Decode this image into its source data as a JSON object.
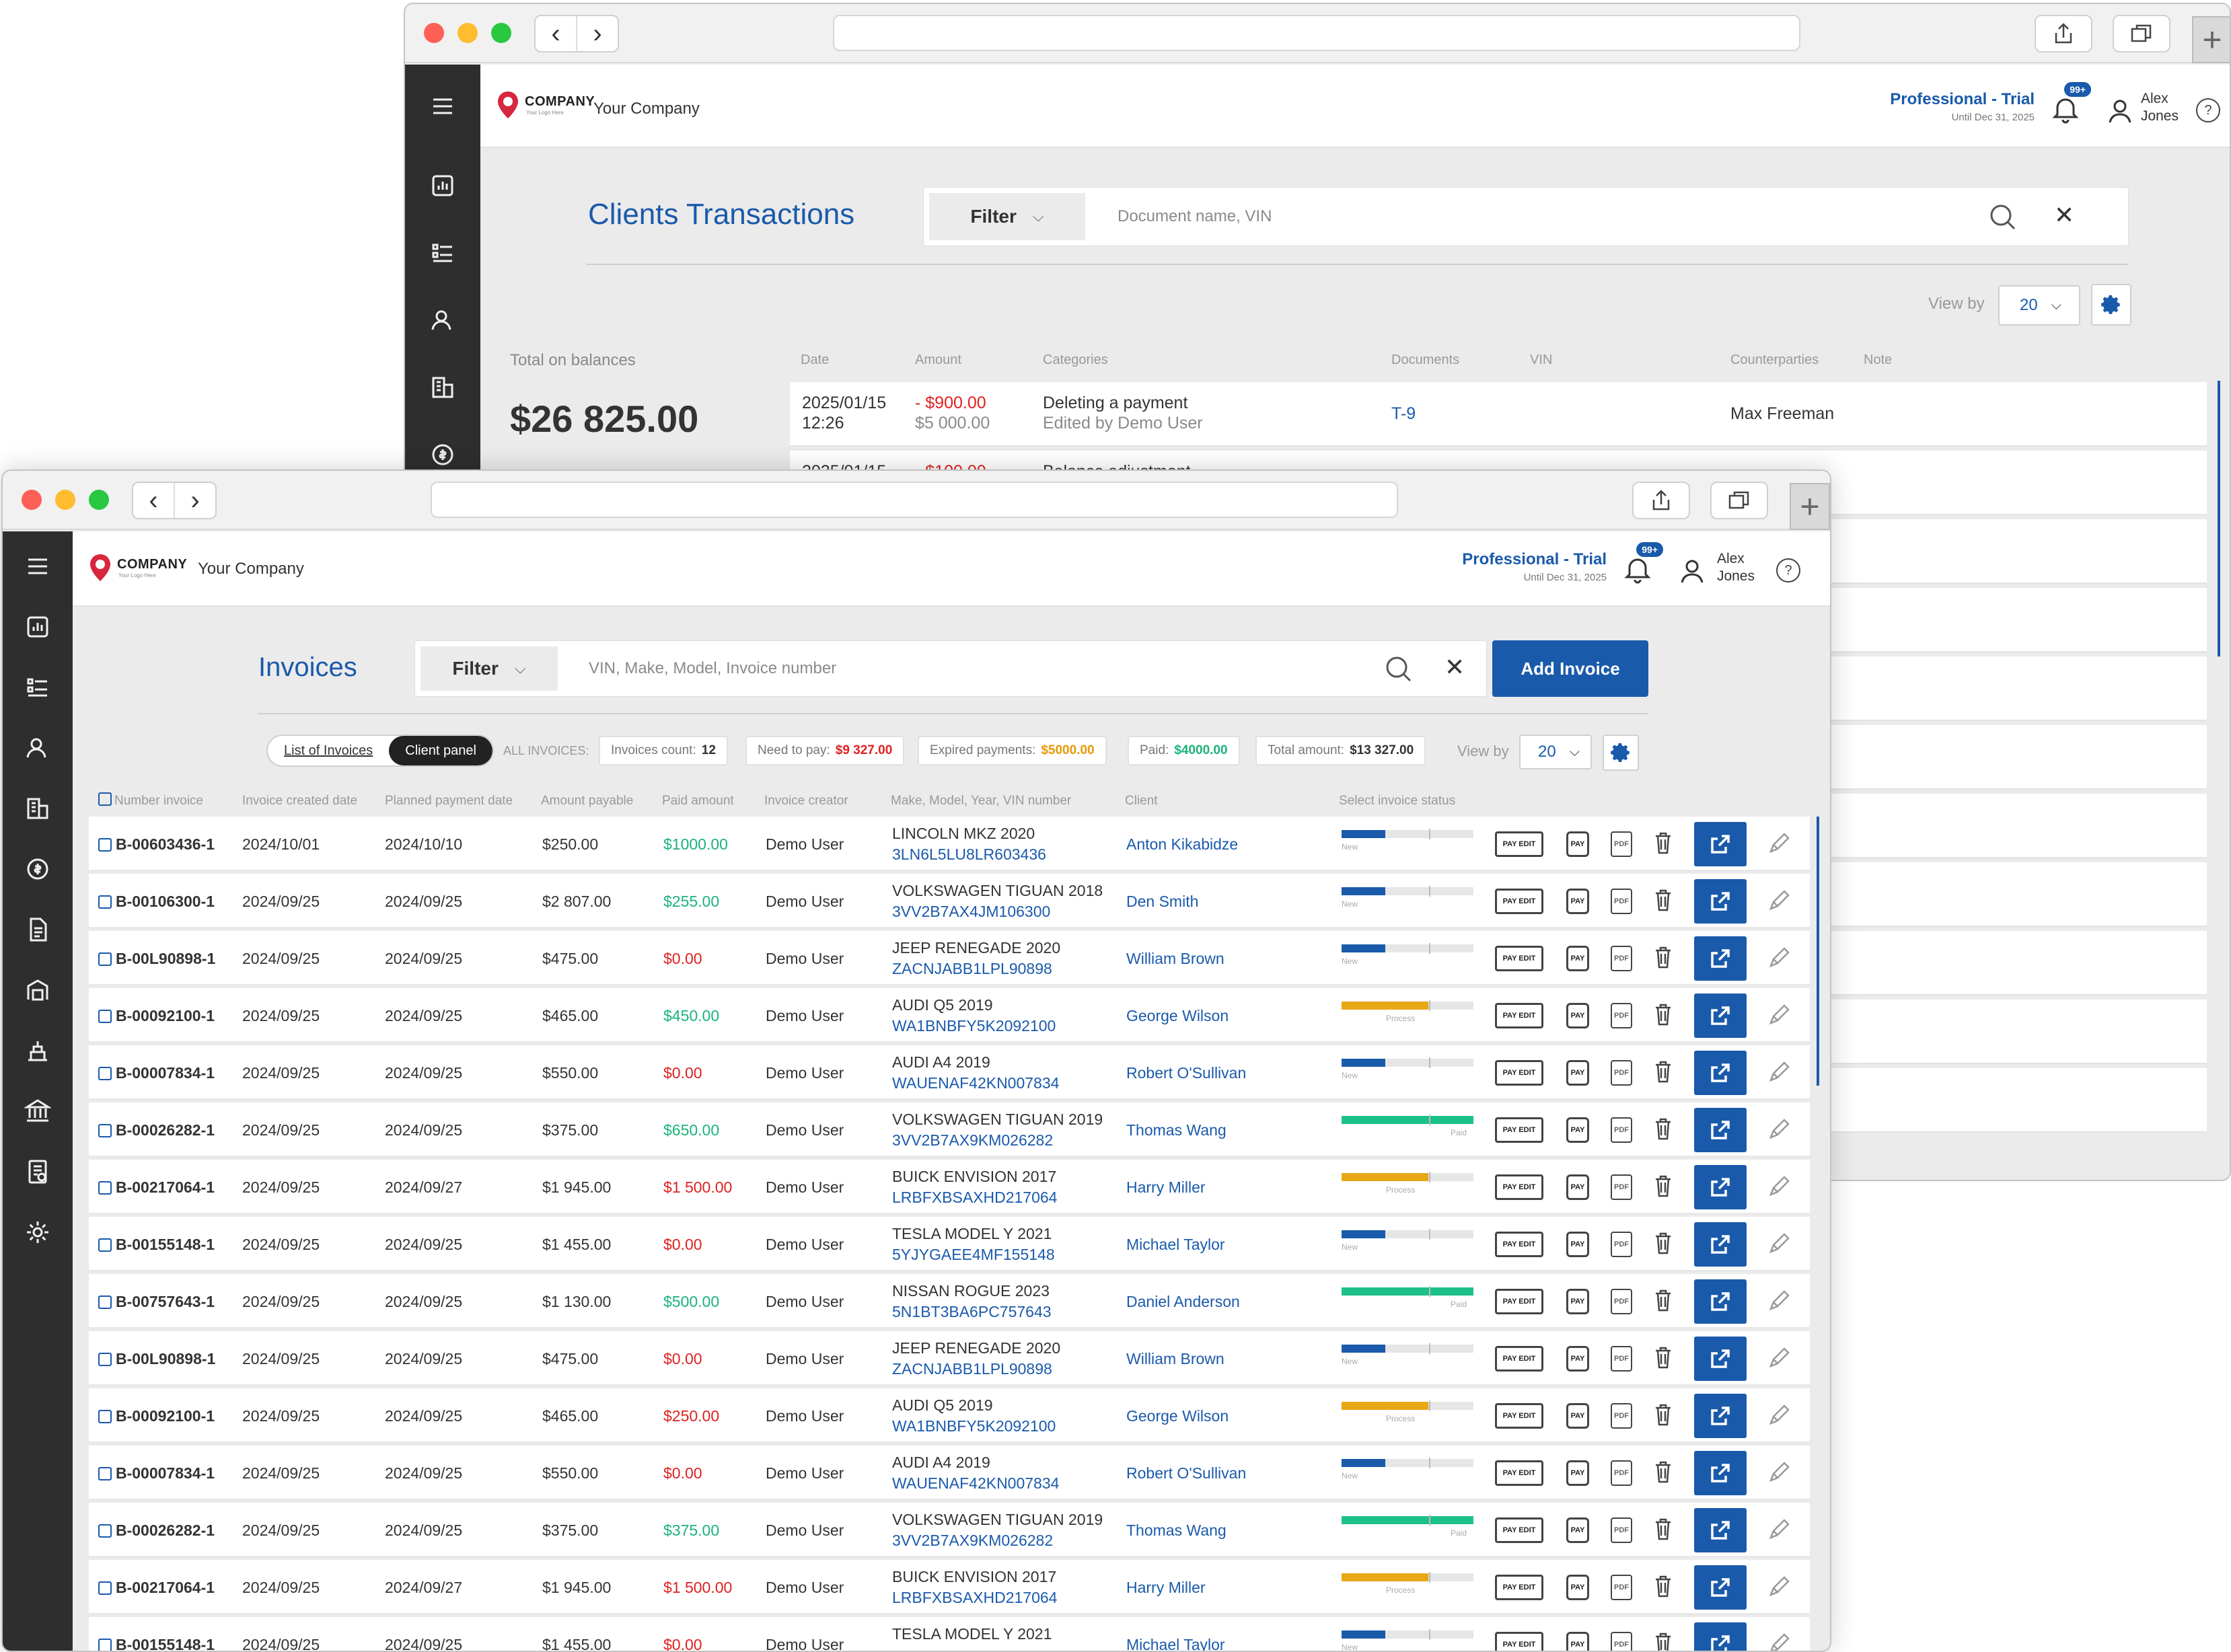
{
  "back_window": {
    "company": {
      "logo_text": "COMPANY",
      "logo_sub": "Your Logo Here",
      "name": "Your Company"
    },
    "plan": {
      "title": "Professional - Trial",
      "subtitle": "Until Dec 31, 2025"
    },
    "notifications_badge": "99+",
    "user": {
      "first": "Alex",
      "last": "Jones"
    },
    "page_title": "Clients Transactions",
    "filter_label": "Filter",
    "search_placeholder": "Document name, VIN",
    "view_by_label": "View by",
    "view_by_value": "20",
    "total_label": "Total on balances",
    "total_value": "$26 825.00",
    "columns": [
      "Date",
      "Amount",
      "Categories",
      "Documents",
      "VIN",
      "Counterparties",
      "Note"
    ],
    "rows": [
      {
        "date": "2025/01/15",
        "time": "12:26",
        "amount": "- $900.00",
        "balance": "$5 000.00",
        "category": "Deleting a payment",
        "edited": "Edited by Demo User",
        "document": "T-9",
        "counterparty": "Max Freeman"
      },
      {
        "date": "2025/01/15",
        "amount": "- $100.00",
        "category": "Balance adjustment"
      }
    ]
  },
  "front_window": {
    "company": {
      "logo_text": "COMPANY",
      "logo_sub": "Your Logo Here",
      "name": "Your Company"
    },
    "plan": {
      "title": "Professional - Trial",
      "subtitle": "Until Dec 31, 2025"
    },
    "notifications_badge": "99+",
    "user": {
      "first": "Alex",
      "last": "Jones"
    },
    "page_title": "Invoices",
    "filter_label": "Filter",
    "search_placeholder": "VIN, Make, Model, Invoice number",
    "add_button": "Add Invoice",
    "tabs": {
      "list": "List of Invoices",
      "client": "Client panel"
    },
    "summary": {
      "all_label": "ALL INVOICES:",
      "count_label": "Invoices count:",
      "count_value": "12",
      "need_label": "Need to pay:",
      "need_value": "$9 327.00",
      "expired_label": "Expired payments:",
      "expired_value": "$5000.00",
      "paid_label": "Paid:",
      "paid_value": "$4000.00",
      "total_label": "Total amount:",
      "total_value": "$13 327.00"
    },
    "view_by_label": "View by",
    "view_by_value": "20",
    "columns": {
      "number": "Number invoice",
      "created": "Invoice created date",
      "planned": "Planned payment date",
      "payable": "Amount payable",
      "paid": "Paid amount",
      "creator": "Invoice creator",
      "car": "Make, Model, Year, VIN number",
      "client": "Client",
      "status": "Select invoice status"
    },
    "action_labels": {
      "pay_edit": "PAY EDIT",
      "pay": "PAY",
      "pdf": "PDF"
    },
    "status_colors": {
      "New": "#1a5aab",
      "Process": "#e8a715",
      "Paid": "#1cc08a"
    },
    "rows": [
      {
        "number": "B-00603436-1",
        "created": "2024/10/01",
        "planned": "2024/10/10",
        "payable": "$250.00",
        "paid": "$1000.00",
        "paid_color": "green",
        "creator": "Demo User",
        "car": "LINCOLN MKZ 2020",
        "vin": "3LN6L5LU8LR603436",
        "client": "Anton Kikabidze",
        "status": "New",
        "progress": 0.33
      },
      {
        "number": "B-00106300-1",
        "created": "2024/09/25",
        "planned": "2024/09/25",
        "payable": "$2 807.00",
        "paid": "$255.00",
        "paid_color": "green",
        "creator": "Demo User",
        "car": "VOLKSWAGEN TIGUAN 2018",
        "vin": "3VV2B7AX4JM106300",
        "client": "Den  Smith",
        "status": "New",
        "progress": 0.33
      },
      {
        "number": "B-00L90898-1",
        "created": "2024/09/25",
        "planned": "2024/09/25",
        "payable": "$475.00",
        "paid": "$0.00",
        "paid_color": "red",
        "creator": "Demo User",
        "car": "JEEP RENEGADE 2020",
        "vin": "ZACNJABB1LPL90898",
        "client": "William Brown",
        "status": "New",
        "progress": 0.33
      },
      {
        "number": "B-00092100-1",
        "created": "2024/09/25",
        "planned": "2024/09/25",
        "payable": "$465.00",
        "paid": "$450.00",
        "paid_color": "green",
        "creator": "Demo User",
        "car": "AUDI Q5 2019",
        "vin": "WA1BNBFY5K2092100",
        "client": "George Wilson",
        "status": "Process",
        "progress": 0.66
      },
      {
        "number": "B-00007834-1",
        "created": "2024/09/25",
        "planned": "2024/09/25",
        "payable": "$550.00",
        "paid": "$0.00",
        "paid_color": "red",
        "creator": "Demo User",
        "car": "AUDI A4 2019",
        "vin": "WAUENAF42KN007834",
        "client": "Robert O'Sullivan",
        "status": "New",
        "progress": 0.33
      },
      {
        "number": "B-00026282-1",
        "created": "2024/09/25",
        "planned": "2024/09/25",
        "payable": "$375.00",
        "paid": "$650.00",
        "paid_color": "green",
        "creator": "Demo User",
        "car": "VOLKSWAGEN TIGUAN 2019",
        "vin": "3VV2B7AX9KM026282",
        "client": "Thomas Wang",
        "status": "Paid",
        "progress": 1.0
      },
      {
        "number": "B-00217064-1",
        "created": "2024/09/25",
        "planned": "2024/09/27",
        "payable": "$1 945.00",
        "paid": "$1 500.00",
        "paid_color": "red",
        "creator": "Demo User",
        "car": "BUICK ENVISION 2017",
        "vin": "LRBFXBSAXHD217064",
        "client": "Harry Miller",
        "status": "Process",
        "progress": 0.66
      },
      {
        "number": "B-00155148-1",
        "created": "2024/09/25",
        "planned": "2024/09/25",
        "payable": "$1 455.00",
        "paid": "$0.00",
        "paid_color": "red",
        "creator": "Demo User",
        "car": "TESLA MODEL Y 2021",
        "vin": "5YJYGAEE4MF155148",
        "client": "Michael Taylor",
        "status": "New",
        "progress": 0.33
      },
      {
        "number": "B-00757643-1",
        "created": "2024/09/25",
        "planned": "2024/09/25",
        "payable": "$1 130.00",
        "paid": "$500.00",
        "paid_color": "green",
        "creator": "Demo User",
        "car": "NISSAN ROGUE 2023",
        "vin": "5N1BT3BA6PC757643",
        "client": "Daniel Anderson",
        "status": "Paid",
        "progress": 1.0
      },
      {
        "number": "B-00L90898-1",
        "created": "2024/09/25",
        "planned": "2024/09/25",
        "payable": "$475.00",
        "paid": "$0.00",
        "paid_color": "red",
        "creator": "Demo User",
        "car": "JEEP RENEGADE 2020",
        "vin": "ZACNJABB1LPL90898",
        "client": "William Brown",
        "status": "New",
        "progress": 0.33
      },
      {
        "number": "B-00092100-1",
        "created": "2024/09/25",
        "planned": "2024/09/25",
        "payable": "$465.00",
        "paid": "$250.00",
        "paid_color": "red",
        "creator": "Demo User",
        "car": "AUDI Q5 2019",
        "vin": "WA1BNBFY5K2092100",
        "client": "George Wilson",
        "status": "Process",
        "progress": 0.66
      },
      {
        "number": "B-00007834-1",
        "created": "2024/09/25",
        "planned": "2024/09/25",
        "payable": "$550.00",
        "paid": "$0.00",
        "paid_color": "red",
        "creator": "Demo User",
        "car": "AUDI A4 2019",
        "vin": "WAUENAF42KN007834",
        "client": "Robert O'Sullivan",
        "status": "New",
        "progress": 0.33
      },
      {
        "number": "B-00026282-1",
        "created": "2024/09/25",
        "planned": "2024/09/25",
        "payable": "$375.00",
        "paid": "$375.00",
        "paid_color": "green",
        "creator": "Demo User",
        "car": "VOLKSWAGEN TIGUAN 2019",
        "vin": "3VV2B7AX9KM026282",
        "client": "Thomas Wang",
        "status": "Paid",
        "progress": 1.0
      },
      {
        "number": "B-00217064-1",
        "created": "2024/09/25",
        "planned": "2024/09/27",
        "payable": "$1 945.00",
        "paid": "$1 500.00",
        "paid_color": "red",
        "creator": "Demo User",
        "car": "BUICK ENVISION 2017",
        "vin": "LRBFXBSAXHD217064",
        "client": "Harry Miller",
        "status": "Process",
        "progress": 0.66
      },
      {
        "number": "B-00155148-1",
        "created": "2024/09/25",
        "planned": "2024/09/25",
        "payable": "$1 455.00",
        "paid": "$0.00",
        "paid_color": "red",
        "creator": "Demo User",
        "car": "TESLA MODEL Y 2021",
        "vin": "",
        "client": "Michael Taylor",
        "status": "New",
        "progress": 0.33
      }
    ]
  }
}
